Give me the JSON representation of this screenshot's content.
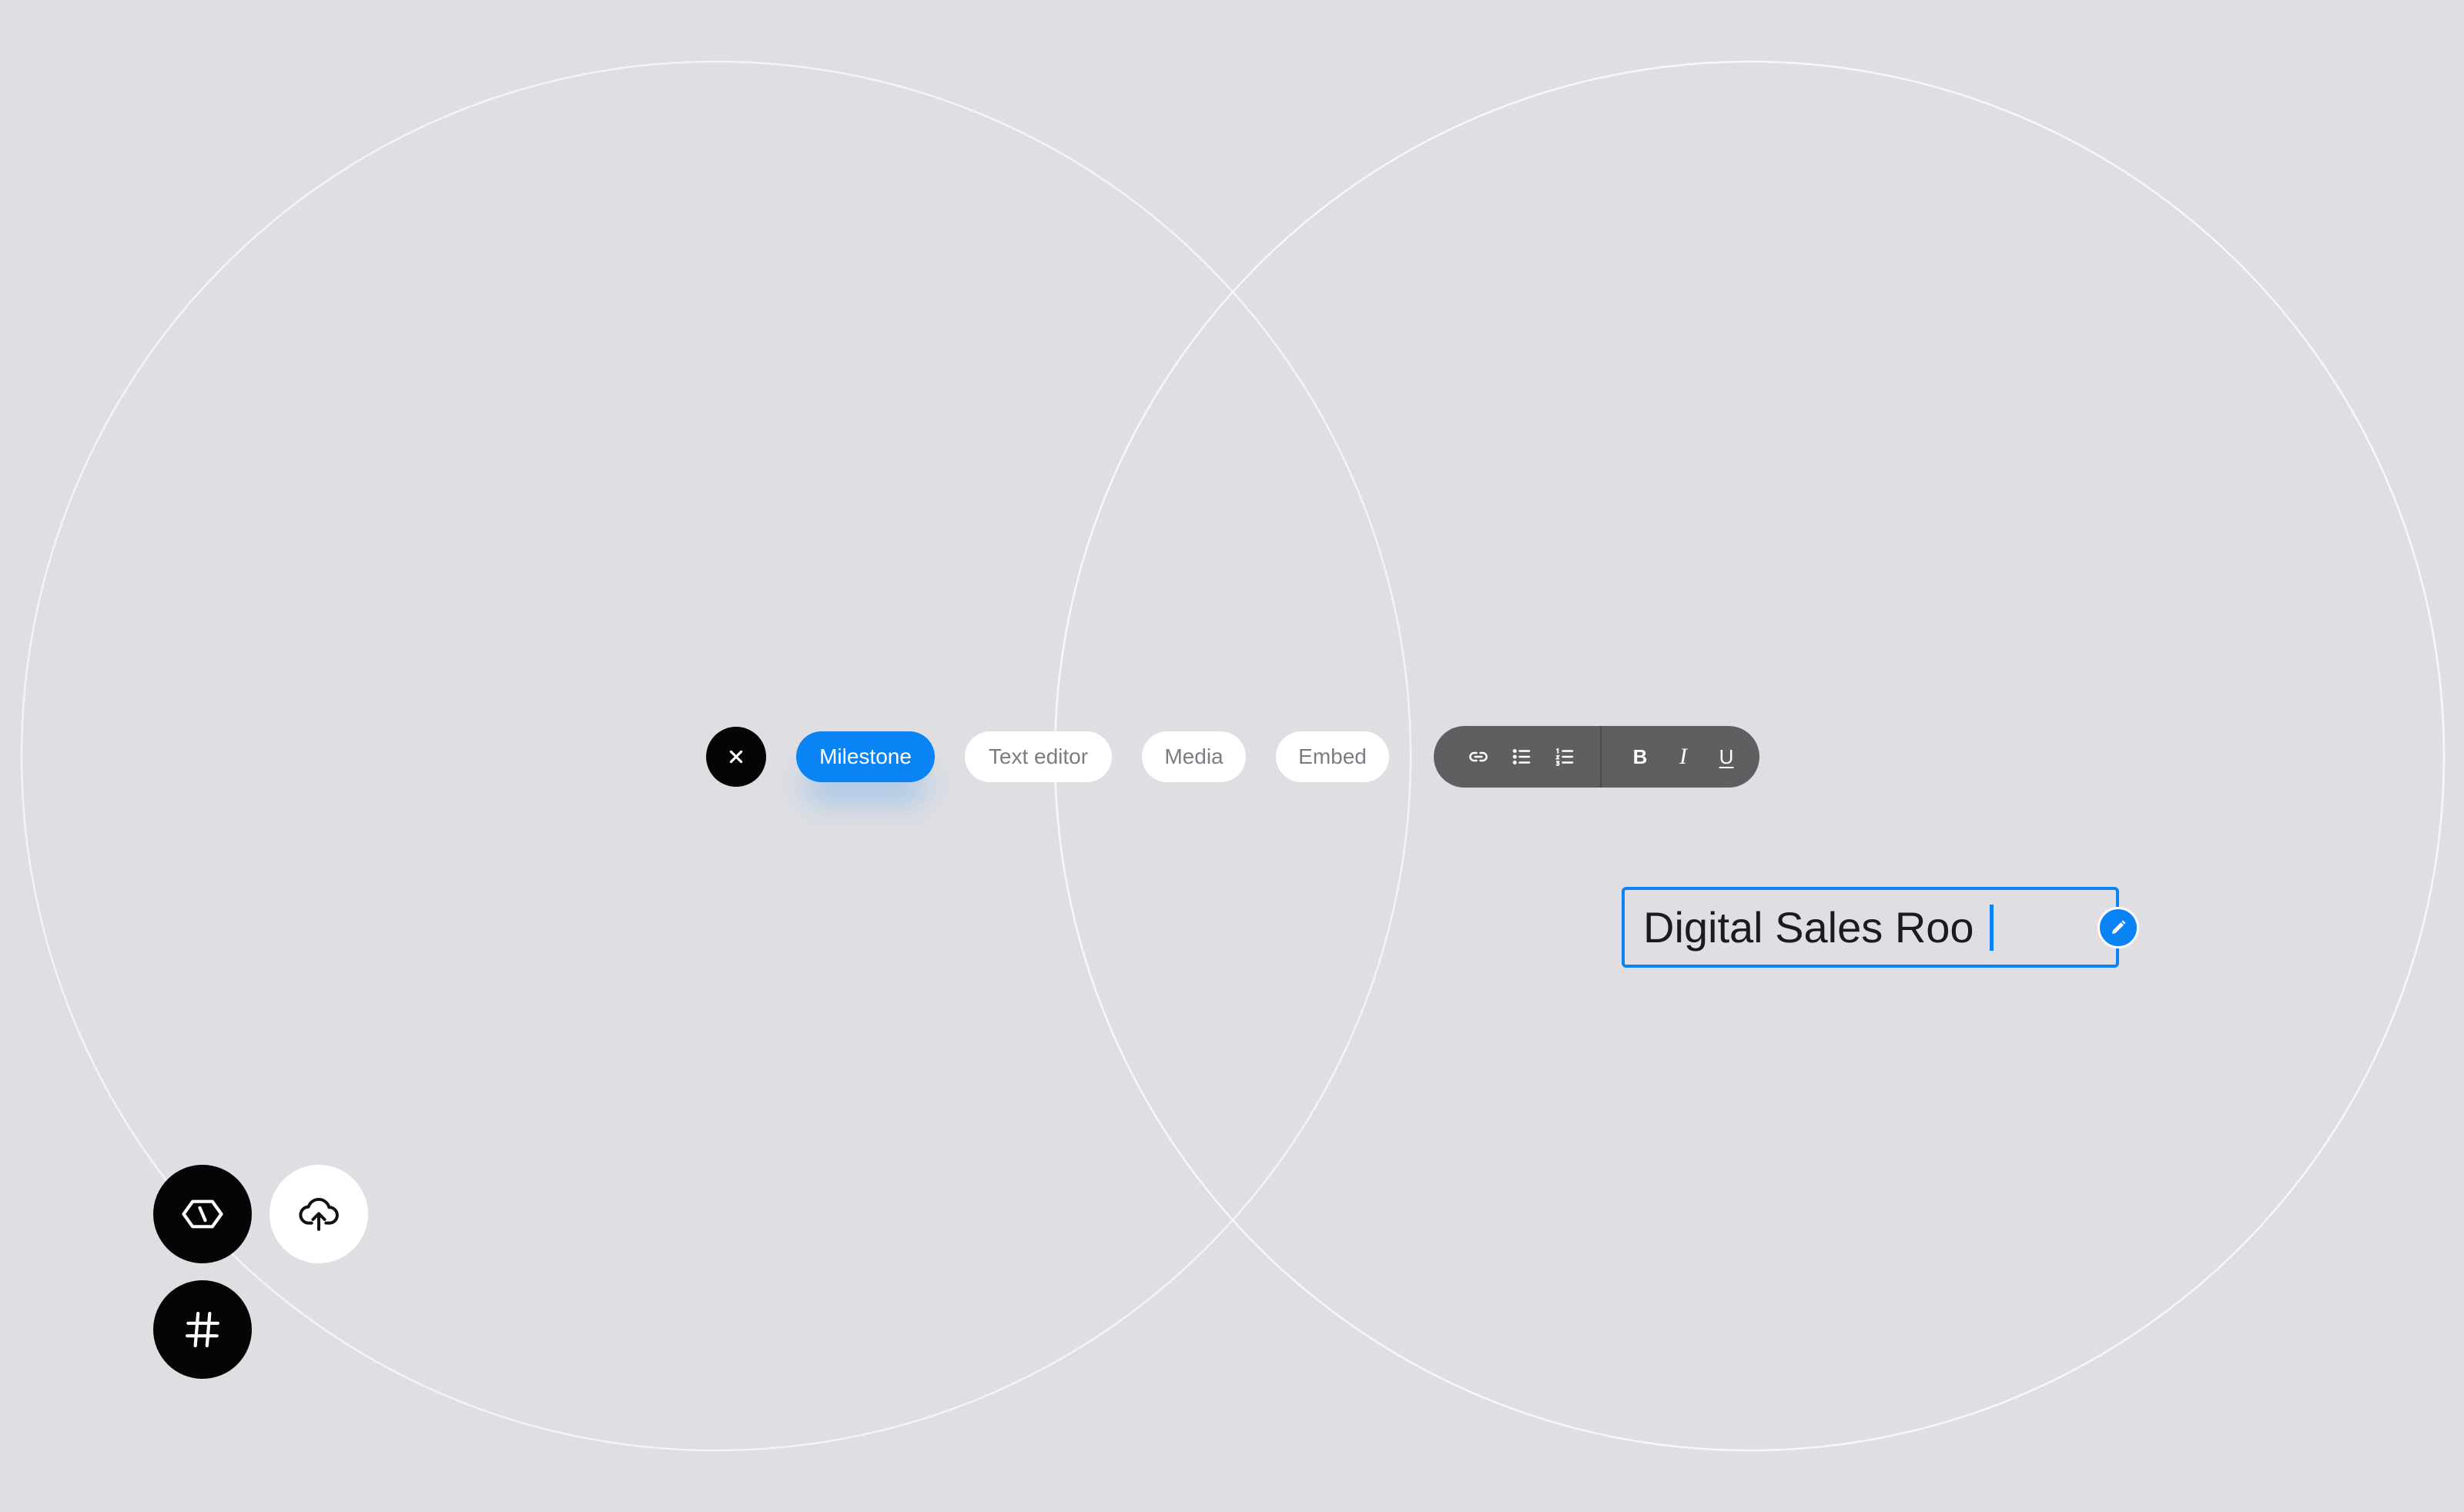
{
  "toolbar": {
    "close_icon": "close-icon",
    "tabs": [
      {
        "label": "Milestone",
        "active": true
      },
      {
        "label": "Text editor",
        "active": false
      },
      {
        "label": "Media",
        "active": false
      },
      {
        "label": "Embed",
        "active": false
      }
    ]
  },
  "format_bar": {
    "icons": [
      "link-icon",
      "bulleted-list-icon",
      "numbered-list-icon"
    ],
    "bold_label": "B",
    "italic_label": "I",
    "underline_label": "U"
  },
  "title_field": {
    "value": "Digital Sales Roo",
    "edit_icon": "pencil-icon"
  },
  "fabs": {
    "icons": [
      "code-hexagon-icon",
      "cloud-upload-icon",
      "hash-icon"
    ]
  },
  "colors": {
    "background": "#dfdfe3",
    "accent": "#0a84f4",
    "dark": "#050505",
    "format_bar": "#5f5f62",
    "circle_stroke": "#f4f4f6"
  }
}
